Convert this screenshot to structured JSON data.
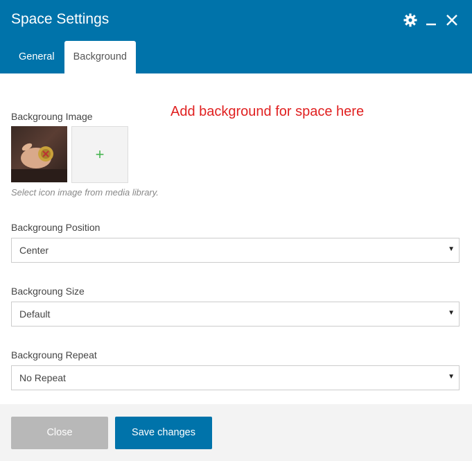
{
  "dialog": {
    "title": "Space Settings",
    "tabs": [
      {
        "label": "General",
        "active": false
      },
      {
        "label": "Background",
        "active": true
      }
    ],
    "icons": [
      "gear-icon",
      "minimize-icon",
      "close-icon"
    ]
  },
  "annotation": "Add background for space here",
  "background_image": {
    "label": "Backgroung Image",
    "add_symbol": "+",
    "hint": "Select icon image from media library."
  },
  "position": {
    "label": "Backgroung Position",
    "value": "Center"
  },
  "size": {
    "label": "Backgroung Size",
    "value": "Default"
  },
  "repeat": {
    "label": "Backgroung Repeat",
    "value": "No Repeat"
  },
  "footer": {
    "close_label": "Close",
    "save_label": "Save changes"
  },
  "colors": {
    "header": "#0073aa",
    "annotation": "#e02020",
    "add_plus": "#46b450",
    "close_button": "#b8b8b8"
  }
}
